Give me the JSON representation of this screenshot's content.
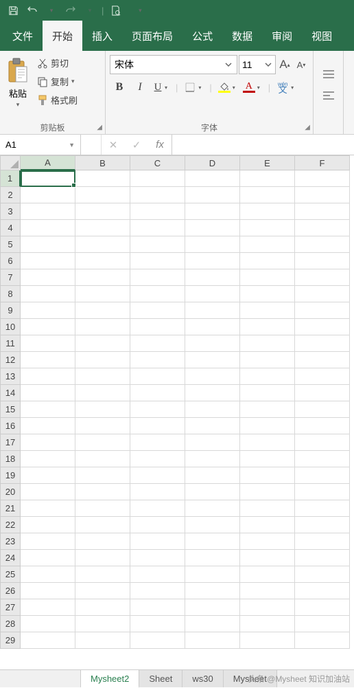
{
  "qat": {
    "save": "save",
    "undo": "undo",
    "redo": "redo",
    "preview": "preview",
    "more": "▾"
  },
  "menu": {
    "file": "文件",
    "home": "开始",
    "insert": "插入",
    "layout": "页面布局",
    "formula": "公式",
    "data": "数据",
    "review": "审阅",
    "view": "视图"
  },
  "clipboard": {
    "paste": "粘贴",
    "cut": "剪切",
    "copy": "复制",
    "format_painter": "格式刷",
    "group_label": "剪贴板"
  },
  "font": {
    "family": "宋体",
    "size": "11",
    "bold": "B",
    "italic": "I",
    "underline": "U",
    "wen": "文",
    "grow": "A",
    "shrink": "A",
    "fill_color": "#ffff00",
    "font_color": "#c00000",
    "group_label": "字体"
  },
  "formula_bar": {
    "name_box": "A1",
    "cancel": "✕",
    "confirm": "✓",
    "fx": "fx"
  },
  "columns": [
    "A",
    "B",
    "C",
    "D",
    "E",
    "F"
  ],
  "rows": [
    1,
    2,
    3,
    4,
    5,
    6,
    7,
    8,
    9,
    10,
    11,
    12,
    13,
    14,
    15,
    16,
    17,
    18,
    19,
    20,
    21,
    22,
    23,
    24,
    25,
    26,
    27,
    28,
    29
  ],
  "selected_cell": "A1",
  "tabs": {
    "active": "Mysheet2",
    "t2": "Sheet",
    "t3": "ws30",
    "t4": "Mysheet"
  },
  "watermark": "头条 @Mysheet 知识加油站"
}
